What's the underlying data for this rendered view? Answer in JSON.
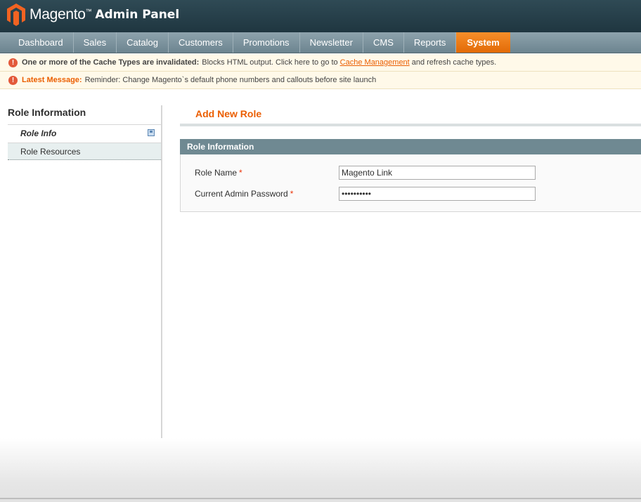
{
  "header": {
    "brand": "Magento",
    "trademark": "™",
    "subtitle": "Admin Panel"
  },
  "nav": {
    "items": [
      "Dashboard",
      "Sales",
      "Catalog",
      "Customers",
      "Promotions",
      "Newsletter",
      "CMS",
      "Reports",
      "System"
    ],
    "active_index": 8
  },
  "notices": {
    "cache_bold": "One or more of the Cache Types are invalidated:",
    "cache_text": "Blocks HTML output. Click here to go to",
    "cache_link": "Cache Management",
    "cache_tail": "and refresh cache types.",
    "latest_label": "Latest Message:",
    "latest_text": "Reminder: Change Magento`s default phone numbers and callouts before site launch"
  },
  "sidebar": {
    "title": "Role Information",
    "tabs": [
      {
        "label": "Role Info",
        "active": true
      },
      {
        "label": "Role Resources",
        "active": false
      }
    ]
  },
  "main": {
    "title": "Add New Role",
    "fieldset_title": "Role Information",
    "fields": {
      "role_name": {
        "label": "Role Name",
        "required_mark": "*",
        "value": "Magento Link"
      },
      "password": {
        "label": "Current Admin Password",
        "required_mark": "*",
        "value": "••••••••••"
      }
    }
  },
  "colors": {
    "accent": "#eb5e00",
    "header_bg": "#253f49",
    "fieldset_head": "#6f8992"
  }
}
